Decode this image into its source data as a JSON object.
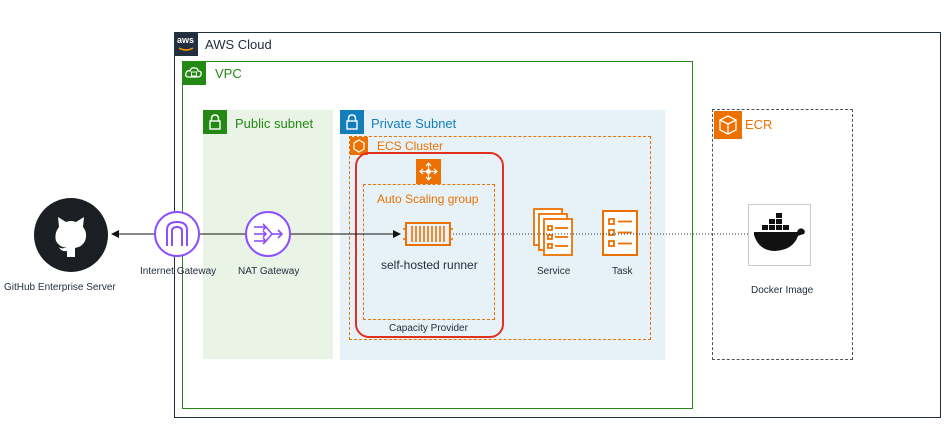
{
  "diagram": {
    "aws_cloud": {
      "label": "AWS Cloud",
      "logo_text": "aws"
    },
    "vpc": {
      "label": "VPC"
    },
    "public_subnet": {
      "label": "Public subnet"
    },
    "private_subnet": {
      "label": "Private Subnet"
    },
    "ecs_cluster": {
      "label": "ECS Cluster"
    },
    "auto_scaling_group": {
      "label": "Auto Scaling group"
    },
    "runner": {
      "label": "self-hosted runner"
    },
    "capacity_provider": {
      "label": "Capacity Provider"
    },
    "service": {
      "label": "Service"
    },
    "task": {
      "label": "Task"
    },
    "ecr": {
      "label": "ECR"
    },
    "docker_image": {
      "label": "Docker Image"
    },
    "github": {
      "label": "GitHub Enterprise Server"
    },
    "internet_gateway": {
      "label": "Internet Gateway"
    },
    "nat_gateway": {
      "label": "NAT Gateway"
    }
  },
  "colors": {
    "vpc_green": "#248814",
    "public_fill": "#e9f3e6",
    "private_fill": "#e6f2f8",
    "private_blue": "#147eba",
    "ecs_orange": "#ed7100",
    "highlight_red": "#e0301e",
    "gateway_purple": "#8c4fff",
    "dark": "#232f3e"
  },
  "icons": [
    "aws-logo-icon",
    "vpc-cloud-icon",
    "lock-icon",
    "ecs-cluster-icon",
    "auto-scaling-icon",
    "ec2-instance-icon",
    "service-icon",
    "task-icon",
    "ecr-icon",
    "docker-icon",
    "github-icon",
    "internet-gateway-icon",
    "nat-gateway-icon"
  ]
}
